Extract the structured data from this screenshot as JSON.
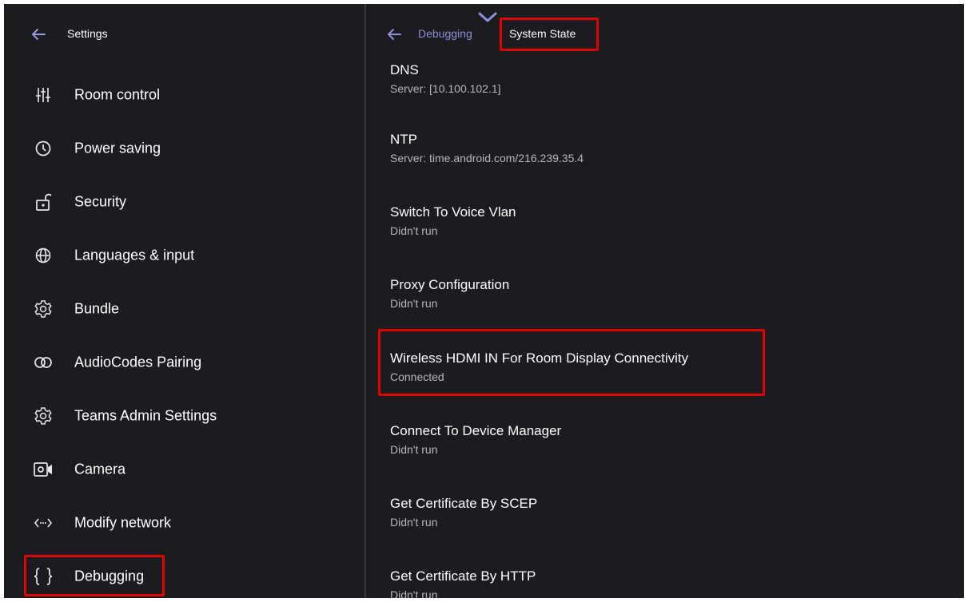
{
  "left_panel": {
    "title": "Settings",
    "items": [
      {
        "label": "Room control",
        "icon": "sliders-icon"
      },
      {
        "label": "Power saving",
        "icon": "clock-icon"
      },
      {
        "label": "Security",
        "icon": "unlock-icon"
      },
      {
        "label": "Languages & input",
        "icon": "globe-icon"
      },
      {
        "label": "Bundle",
        "icon": "gear-icon"
      },
      {
        "label": "AudioCodes Pairing",
        "icon": "link-rings-icon"
      },
      {
        "label": "Teams Admin Settings",
        "icon": "gear-icon"
      },
      {
        "label": "Camera",
        "icon": "camera-icon"
      },
      {
        "label": "Modify network",
        "icon": "code-arrows-icon"
      },
      {
        "label": "Debugging",
        "icon": "braces-icon"
      }
    ]
  },
  "right_panel": {
    "breadcrumb": {
      "parent": "Debugging",
      "current": "System State"
    },
    "entries": [
      {
        "title": "DNS",
        "subtitle": "Server: [10.100.102.1]"
      },
      {
        "title": "NTP",
        "subtitle": "Server: time.android.com/216.239.35.4"
      },
      {
        "title": "Switch To Voice Vlan",
        "subtitle": "Didn't run"
      },
      {
        "title": "Proxy Configuration",
        "subtitle": "Didn't run"
      },
      {
        "title": "Wireless HDMI IN For Room Display Connectivity",
        "subtitle": "Connected"
      },
      {
        "title": "Connect To Device Manager",
        "subtitle": "Didn't run"
      },
      {
        "title": "Get Certificate By SCEP",
        "subtitle": "Didn't run"
      },
      {
        "title": "Get Certificate By HTTP",
        "subtitle": "Didn't run"
      }
    ]
  },
  "colors": {
    "background": "#1c1b20",
    "accent": "#8f8fd6",
    "highlight": "#e00000"
  }
}
